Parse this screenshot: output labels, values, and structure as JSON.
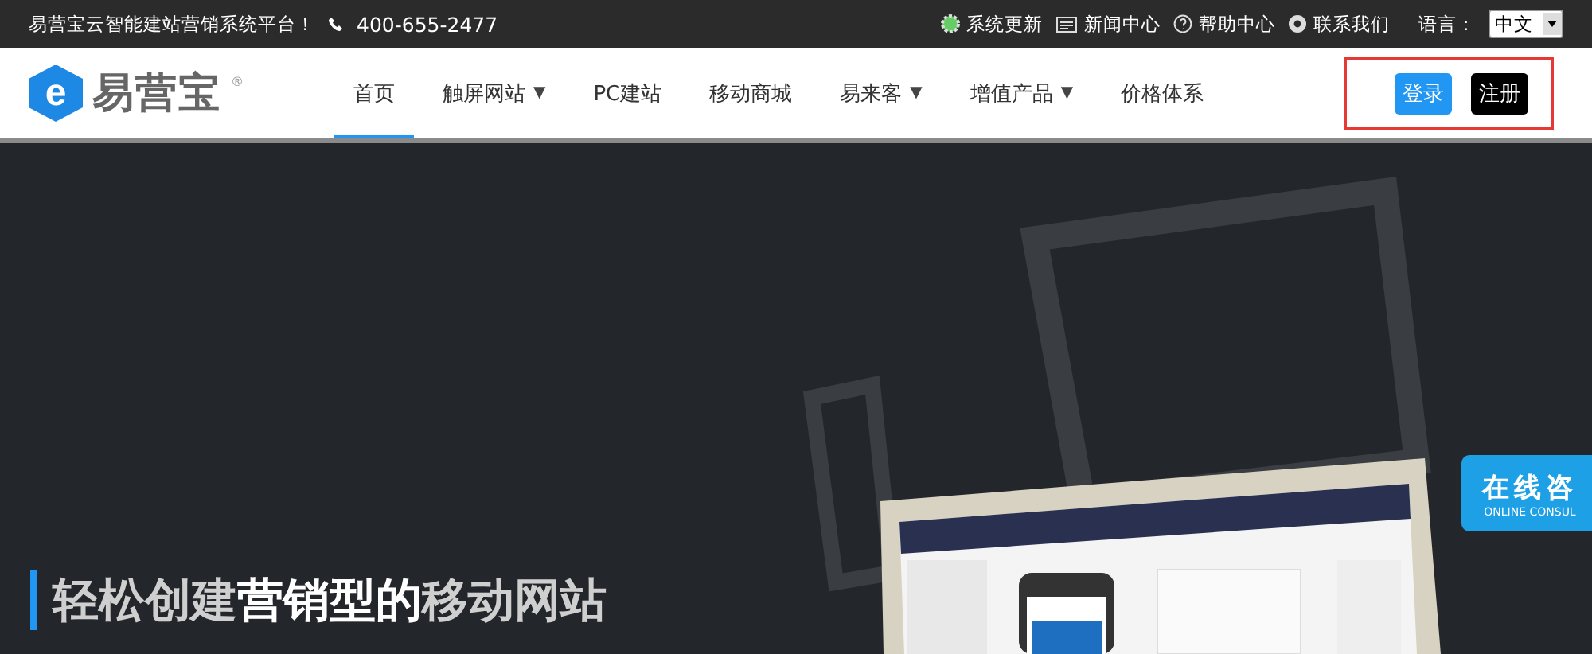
{
  "top_bar": {
    "slogan": "易营宝云智能建站营销系统平台！",
    "phone": "400-655-2477",
    "links": [
      {
        "label": "系统更新",
        "kind": "update"
      },
      {
        "label": "新闻中心",
        "kind": "news"
      },
      {
        "label": "帮助中心",
        "kind": "help"
      },
      {
        "label": "联系我们",
        "kind": "contact"
      }
    ],
    "language": {
      "label": "语言：",
      "value": "中文"
    }
  },
  "nav": {
    "logo_mark": "e",
    "logo_text": "易营宝",
    "logo_reg": "®",
    "items": [
      {
        "label": "首页",
        "selected": true
      },
      {
        "label": "触屏网站",
        "selected": false,
        "arrow": "▼"
      },
      {
        "label": "PC建站",
        "selected": false
      },
      {
        "label": "移动商城",
        "selected": false
      },
      {
        "label": "易来客",
        "selected": false,
        "arrow": "▼"
      },
      {
        "label": "增值产品",
        "selected": false,
        "arrow": "▼"
      },
      {
        "label": "价格体系",
        "selected": false
      }
    ],
    "login": "登录",
    "register": "注册"
  },
  "hero": {
    "title": "轻松创建**营销型的**移动网站",
    "consult": {
      "title": "在线咨",
      "subtitle": "ONLINE CONSUL"
    }
  }
}
